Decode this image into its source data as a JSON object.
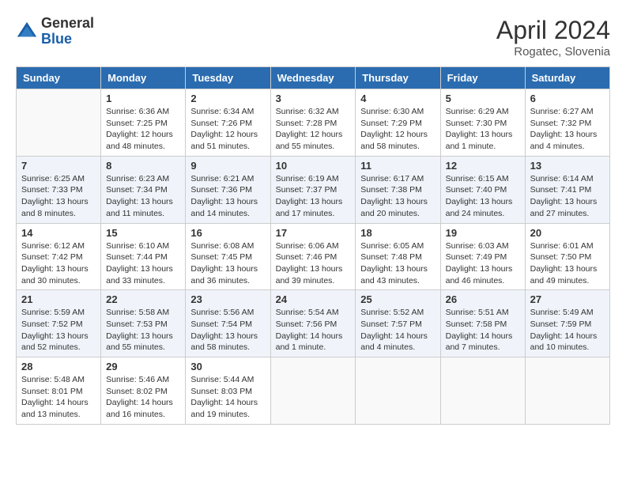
{
  "header": {
    "logo": {
      "general": "General",
      "blue": "Blue"
    },
    "title": "April 2024",
    "location": "Rogatec, Slovenia"
  },
  "weekdays": [
    "Sunday",
    "Monday",
    "Tuesday",
    "Wednesday",
    "Thursday",
    "Friday",
    "Saturday"
  ],
  "weeks": [
    [
      {
        "day": "",
        "info": ""
      },
      {
        "day": "1",
        "info": "Sunrise: 6:36 AM\nSunset: 7:25 PM\nDaylight: 12 hours\nand 48 minutes."
      },
      {
        "day": "2",
        "info": "Sunrise: 6:34 AM\nSunset: 7:26 PM\nDaylight: 12 hours\nand 51 minutes."
      },
      {
        "day": "3",
        "info": "Sunrise: 6:32 AM\nSunset: 7:28 PM\nDaylight: 12 hours\nand 55 minutes."
      },
      {
        "day": "4",
        "info": "Sunrise: 6:30 AM\nSunset: 7:29 PM\nDaylight: 12 hours\nand 58 minutes."
      },
      {
        "day": "5",
        "info": "Sunrise: 6:29 AM\nSunset: 7:30 PM\nDaylight: 13 hours\nand 1 minute."
      },
      {
        "day": "6",
        "info": "Sunrise: 6:27 AM\nSunset: 7:32 PM\nDaylight: 13 hours\nand 4 minutes."
      }
    ],
    [
      {
        "day": "7",
        "info": "Sunrise: 6:25 AM\nSunset: 7:33 PM\nDaylight: 13 hours\nand 8 minutes."
      },
      {
        "day": "8",
        "info": "Sunrise: 6:23 AM\nSunset: 7:34 PM\nDaylight: 13 hours\nand 11 minutes."
      },
      {
        "day": "9",
        "info": "Sunrise: 6:21 AM\nSunset: 7:36 PM\nDaylight: 13 hours\nand 14 minutes."
      },
      {
        "day": "10",
        "info": "Sunrise: 6:19 AM\nSunset: 7:37 PM\nDaylight: 13 hours\nand 17 minutes."
      },
      {
        "day": "11",
        "info": "Sunrise: 6:17 AM\nSunset: 7:38 PM\nDaylight: 13 hours\nand 20 minutes."
      },
      {
        "day": "12",
        "info": "Sunrise: 6:15 AM\nSunset: 7:40 PM\nDaylight: 13 hours\nand 24 minutes."
      },
      {
        "day": "13",
        "info": "Sunrise: 6:14 AM\nSunset: 7:41 PM\nDaylight: 13 hours\nand 27 minutes."
      }
    ],
    [
      {
        "day": "14",
        "info": "Sunrise: 6:12 AM\nSunset: 7:42 PM\nDaylight: 13 hours\nand 30 minutes."
      },
      {
        "day": "15",
        "info": "Sunrise: 6:10 AM\nSunset: 7:44 PM\nDaylight: 13 hours\nand 33 minutes."
      },
      {
        "day": "16",
        "info": "Sunrise: 6:08 AM\nSunset: 7:45 PM\nDaylight: 13 hours\nand 36 minutes."
      },
      {
        "day": "17",
        "info": "Sunrise: 6:06 AM\nSunset: 7:46 PM\nDaylight: 13 hours\nand 39 minutes."
      },
      {
        "day": "18",
        "info": "Sunrise: 6:05 AM\nSunset: 7:48 PM\nDaylight: 13 hours\nand 43 minutes."
      },
      {
        "day": "19",
        "info": "Sunrise: 6:03 AM\nSunset: 7:49 PM\nDaylight: 13 hours\nand 46 minutes."
      },
      {
        "day": "20",
        "info": "Sunrise: 6:01 AM\nSunset: 7:50 PM\nDaylight: 13 hours\nand 49 minutes."
      }
    ],
    [
      {
        "day": "21",
        "info": "Sunrise: 5:59 AM\nSunset: 7:52 PM\nDaylight: 13 hours\nand 52 minutes."
      },
      {
        "day": "22",
        "info": "Sunrise: 5:58 AM\nSunset: 7:53 PM\nDaylight: 13 hours\nand 55 minutes."
      },
      {
        "day": "23",
        "info": "Sunrise: 5:56 AM\nSunset: 7:54 PM\nDaylight: 13 hours\nand 58 minutes."
      },
      {
        "day": "24",
        "info": "Sunrise: 5:54 AM\nSunset: 7:56 PM\nDaylight: 14 hours\nand 1 minute."
      },
      {
        "day": "25",
        "info": "Sunrise: 5:52 AM\nSunset: 7:57 PM\nDaylight: 14 hours\nand 4 minutes."
      },
      {
        "day": "26",
        "info": "Sunrise: 5:51 AM\nSunset: 7:58 PM\nDaylight: 14 hours\nand 7 minutes."
      },
      {
        "day": "27",
        "info": "Sunrise: 5:49 AM\nSunset: 7:59 PM\nDaylight: 14 hours\nand 10 minutes."
      }
    ],
    [
      {
        "day": "28",
        "info": "Sunrise: 5:48 AM\nSunset: 8:01 PM\nDaylight: 14 hours\nand 13 minutes."
      },
      {
        "day": "29",
        "info": "Sunrise: 5:46 AM\nSunset: 8:02 PM\nDaylight: 14 hours\nand 16 minutes."
      },
      {
        "day": "30",
        "info": "Sunrise: 5:44 AM\nSunset: 8:03 PM\nDaylight: 14 hours\nand 19 minutes."
      },
      {
        "day": "",
        "info": ""
      },
      {
        "day": "",
        "info": ""
      },
      {
        "day": "",
        "info": ""
      },
      {
        "day": "",
        "info": ""
      }
    ]
  ]
}
